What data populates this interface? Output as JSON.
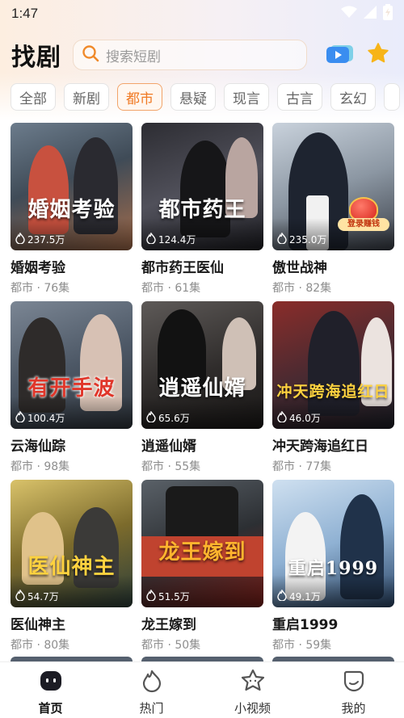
{
  "status_bar": {
    "time": "1:47"
  },
  "header": {
    "title": "找剧",
    "search_placeholder": "搜索短剧"
  },
  "categories": [
    "全部",
    "新剧",
    "都市",
    "悬疑",
    "现言",
    "古言",
    "玄幻"
  ],
  "active_category": "都市",
  "dramas": [
    {
      "title": "婚姻考验",
      "poster_title": "婚姻考验",
      "plays": "237.5万",
      "genre": "都市",
      "episodes": "76集",
      "meta": "都市 · 76集"
    },
    {
      "title": "都市药王医仙",
      "poster_title": "都市药王",
      "plays": "124.4万",
      "genre": "都市",
      "episodes": "61集",
      "meta": "都市 · 61集"
    },
    {
      "title": "傲世战神",
      "poster_title": "",
      "plays": "235.0万",
      "genre": "都市",
      "episodes": "82集",
      "meta": "都市 · 82集",
      "badge": "登录赚钱"
    },
    {
      "title": "云海仙踪",
      "poster_title": "有开手波",
      "plays": "100.4万",
      "genre": "都市",
      "episodes": "98集",
      "meta": "都市 · 98集"
    },
    {
      "title": "逍遥仙婿",
      "poster_title": "逍遥仙婿",
      "plays": "65.6万",
      "genre": "都市",
      "episodes": "55集",
      "meta": "都市 · 55集"
    },
    {
      "title": "冲天跨海追红日",
      "poster_title": "冲天跨海追红日",
      "plays": "46.0万",
      "genre": "都市",
      "episodes": "77集",
      "meta": "都市 · 77集"
    },
    {
      "title": "医仙神主",
      "poster_title": "医仙神主",
      "plays": "54.7万",
      "genre": "都市",
      "episodes": "80集",
      "meta": "都市 · 80集"
    },
    {
      "title": "龙王嫁到",
      "poster_title": "龙王嫁到",
      "plays": "51.5万",
      "genre": "都市",
      "episodes": "50集",
      "meta": "都市 · 50集"
    },
    {
      "title": "重启1999",
      "poster_title": "重启1999",
      "plays": "49.1万",
      "genre": "都市",
      "episodes": "59集",
      "meta": "都市 · 59集"
    }
  ],
  "tabs": [
    {
      "label": "首页",
      "icon": "home-icon",
      "active": true
    },
    {
      "label": "热门",
      "icon": "flame-icon",
      "active": false
    },
    {
      "label": "小视频",
      "icon": "star-face-icon",
      "active": false
    },
    {
      "label": "我的",
      "icon": "profile-icon",
      "active": false
    }
  ],
  "colors": {
    "accent": "#f07a24",
    "active_chip_border": "#f2a46a",
    "meta_text": "#8e8e8e",
    "star_icon": "#f7b418",
    "video_icon": "#3a8df0"
  },
  "posters": [
    {
      "bg": "linear-gradient(160deg,#6c7c8c 0%,#3f4b57 45%,#a56d4b 100%)",
      "fig1": "#2a2a30",
      "fig2": "#c8513f"
    },
    {
      "bg": "linear-gradient(160deg,#2d2d33 0%,#50505a 50%,#1f1f24 100%)",
      "fig1": "#161618",
      "fig2": "#b9a5a0"
    },
    {
      "bg": "linear-gradient(160deg,#c9d2dc 0%,#8c97a3 50%,#3a3f48 100%)",
      "fig1": "#1e2430",
      "fig2": "#f1f1f1"
    },
    {
      "bg": "linear-gradient(160deg,#7b8694 0%,#4d5866 50%,#2f353c 100%)",
      "fig1": "#2e2b2a",
      "fig2": "#d7c1b4"
    },
    {
      "bg": "linear-gradient(160deg,#5e5a58 0%,#2f2c2b 55%,#1a1817 100%)",
      "fig1": "#cfc0b6",
      "fig2": "#121212"
    },
    {
      "bg": "linear-gradient(160deg,#8a2d2a 0%,#4a2a31 50%,#1d1f27 100%)",
      "fig1": "#20202a",
      "fig2": "#ebe3df"
    },
    {
      "bg": "linear-gradient(160deg,#d9c26a 0%,#7c6b2c 50%,#2c3e3a 100%)",
      "fig1": "#e0c28a",
      "fig2": "#3b3a38"
    },
    {
      "bg": "linear-gradient(160deg,#5a6168 0%,#2c2f33 50%,#7a1e18 100%)",
      "fig1": "#1a1a1a",
      "fig2": "#c0432f"
    },
    {
      "bg": "linear-gradient(160deg,#cfe0f0 0%,#8fb1d3 50%,#2b4668 100%)",
      "fig1": "#f3f3f3",
      "fig2": "#20324a"
    }
  ]
}
